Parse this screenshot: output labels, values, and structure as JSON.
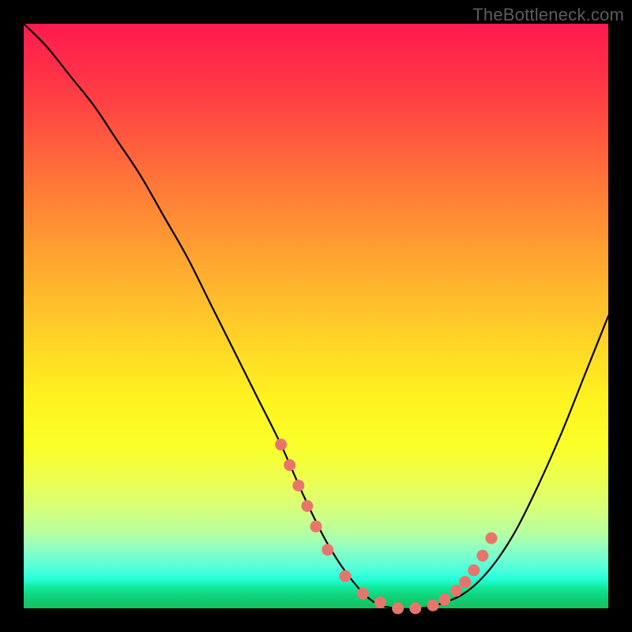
{
  "watermark": "TheBottleneck.com",
  "colors": {
    "background": "#000000",
    "curve": "#000000",
    "marker": "#e8756b",
    "gradient_top": "#ff1a4e",
    "gradient_bottom": "#14c060"
  },
  "chart_data": {
    "type": "line",
    "title": "",
    "xlabel": "",
    "ylabel": "",
    "xlim": [
      0,
      100
    ],
    "ylim": [
      0,
      100
    ],
    "grid": false,
    "legend": false,
    "annotations": [
      "TheBottleneck.com"
    ],
    "series": [
      {
        "name": "bottleneck-curve",
        "x": [
          0,
          4,
          8,
          12,
          16,
          20,
          24,
          28,
          32,
          36,
          40,
          44,
          48,
          52,
          56,
          60,
          64,
          68,
          72,
          76,
          80,
          84,
          88,
          92,
          96,
          100
        ],
        "y": [
          100,
          96,
          91,
          86,
          80,
          74,
          67,
          60,
          52,
          44,
          36,
          28,
          19,
          11,
          5,
          1,
          0,
          0,
          1,
          3,
          7,
          13,
          21,
          30,
          40,
          50
        ]
      }
    ],
    "markers": {
      "name": "highlighted-points",
      "x": [
        44,
        45.5,
        47,
        48.5,
        50,
        52,
        55,
        58,
        61,
        64,
        67,
        70,
        72,
        74,
        75.5,
        77,
        78.5,
        80
      ],
      "y": [
        28,
        24.5,
        21,
        17.5,
        14,
        10,
        5.5,
        2.5,
        1,
        0,
        0,
        0.5,
        1.5,
        3,
        4.5,
        6.5,
        9,
        12
      ]
    }
  }
}
